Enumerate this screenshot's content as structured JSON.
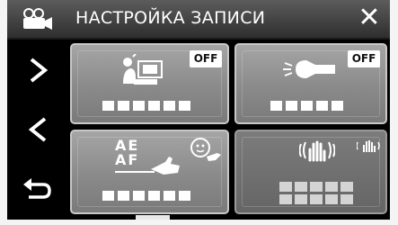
{
  "header": {
    "title": "НАСТРОЙКА ЗАПИСИ",
    "close_glyph": "✕"
  },
  "icons": {
    "mode": "video-camera-icon",
    "next": "chevron-right-icon",
    "prev": "chevron-left-icon",
    "back": "return-arrow-icon",
    "close": "close-icon"
  },
  "tiles": [
    {
      "icon": "backlight-compensation-icon",
      "badge": "OFF"
    },
    {
      "icon": "light-icon",
      "badge": "OFF"
    },
    {
      "icon": "touch-ae-af-icon",
      "icon_text_ae": "AE",
      "icon_text_af": "AF"
    },
    {
      "icon": "image-stabilizer-icon"
    }
  ],
  "colors": {
    "header": "#3f3f3f",
    "tile": "#8f8f8f",
    "background": "#000000"
  }
}
